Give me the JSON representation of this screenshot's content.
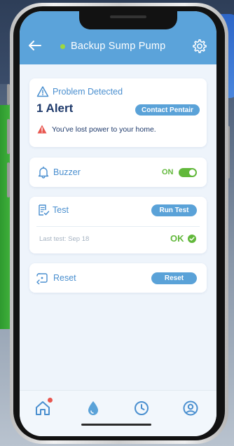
{
  "header": {
    "title": "Backup Sump Pump",
    "status_color": "#9ed83e",
    "accent_color": "#5ba3da"
  },
  "alert_card": {
    "heading": "Problem Detected",
    "alert_count": "1 Alert",
    "contact_label": "Contact Pentair",
    "message": "You've lost power to your home."
  },
  "buzzer": {
    "label": "Buzzer",
    "state_label": "ON",
    "enabled": true
  },
  "test": {
    "label": "Test",
    "run_label": "Run Test",
    "last_test": "Last test: Sep 18",
    "result": "OK"
  },
  "reset": {
    "label": "Reset",
    "button_label": "Reset"
  },
  "bottom_nav": {
    "items": [
      {
        "icon": "home-icon",
        "has_badge": true
      },
      {
        "icon": "water-drop-icon",
        "has_badge": false
      },
      {
        "icon": "clock-icon",
        "has_badge": false
      },
      {
        "icon": "account-icon",
        "has_badge": false
      }
    ]
  },
  "colors": {
    "success": "#62b83b",
    "danger": "#e8564f",
    "primary_text": "#1f3a6b",
    "label_text": "#4a8fcf"
  }
}
